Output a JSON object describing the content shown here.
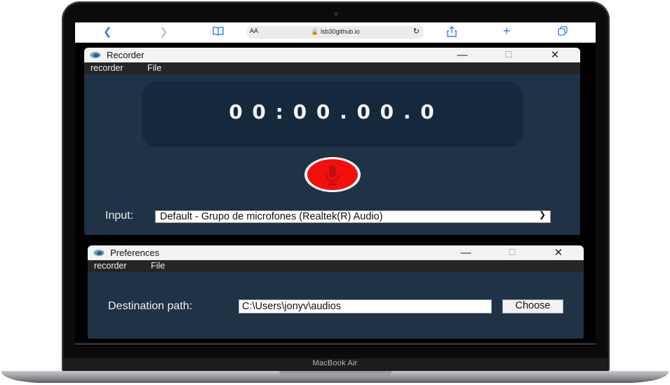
{
  "browser": {
    "url": "lsb30github.io",
    "aa_label": "AA",
    "icons": [
      "back-icon",
      "forward-icon",
      "bookmarks-icon",
      "reload-icon",
      "share-icon",
      "new-tab-icon",
      "tabs-icon"
    ]
  },
  "recorder_window": {
    "title": "Recorder",
    "menu": [
      "recorder",
      "File"
    ],
    "timer": "00:00.00.0",
    "input_label": "Input:",
    "input_value": "Default - Grupo de microfones (Realtek(R) Audio)",
    "record_button_color": "#f40f0c"
  },
  "preferences_window": {
    "title": "Preferences",
    "menu": [
      "recorder",
      "File"
    ],
    "destination_label": "Destination path:",
    "destination_value": "C:\\Users\\jonyv\\audios",
    "choose_label": "Choose"
  },
  "device": {
    "model": "MacBook Air"
  },
  "colors": {
    "window_bg": "#1f3246",
    "timer_bg": "#15283c",
    "menubar_bg": "#252525",
    "record_red": "#f40f0c",
    "browser_accent": "#2f7ef6"
  }
}
